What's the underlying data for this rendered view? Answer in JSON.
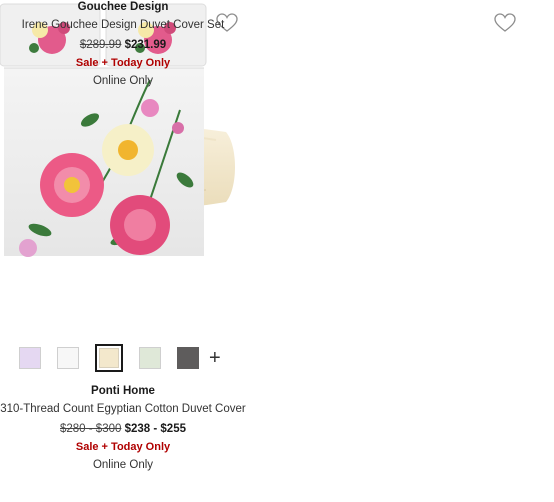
{
  "products": [
    {
      "brand": "Ponti Home",
      "name": "310-Thread Count Egyptian Cotton Duvet Cover",
      "price_was": "$280 - $300",
      "price_now": "$238 - $255",
      "promo": "Sale + Today Only",
      "availability": "Online Only",
      "wishlist_icon": "heart-outline-icon",
      "swatches": [
        {
          "name": "lavender",
          "color": "#e5d8f2"
        },
        {
          "name": "white",
          "color": "#f7f7f7"
        },
        {
          "name": "ivory",
          "color": "#f3e8cc",
          "selected": true
        },
        {
          "name": "sage",
          "color": "#dfe8d8"
        },
        {
          "name": "charcoal",
          "color": "#5e5c5c"
        }
      ],
      "more_colors_label": "+"
    },
    {
      "brand": "Gouchee Design",
      "name": "Irene Gouchee Design Duvet Cover Set",
      "price_was": "$289.99",
      "price_now": "$231.99",
      "promo": "Sale + Today Only",
      "availability": "Online Only",
      "wishlist_icon": "heart-outline-icon"
    }
  ],
  "colors": {
    "sale_red": "#b00000",
    "heart_stroke": "#8c8c8c",
    "duvet_cream": "#f5ecd7"
  }
}
